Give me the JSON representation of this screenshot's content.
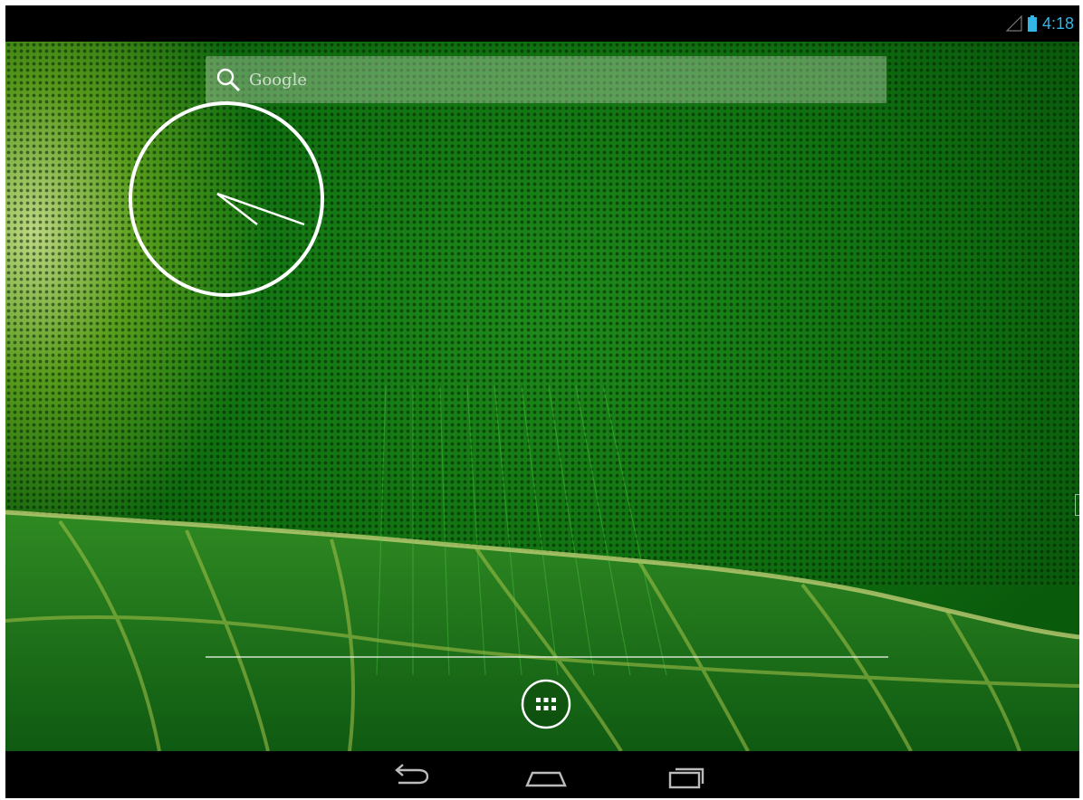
{
  "status_bar": {
    "time": "4:18",
    "icons": [
      "signal-icon",
      "battery-icon"
    ],
    "time_color": "#33b5e5"
  },
  "search_widget": {
    "label": "Google",
    "icon": "search-icon"
  },
  "clock_widget": {
    "type": "analog",
    "shows_time": "4:18"
  },
  "dock": {
    "app_drawer_icon": "apps-grid-icon"
  },
  "nav_bar": {
    "buttons": [
      "back-icon",
      "home-icon",
      "recents-icon"
    ]
  }
}
